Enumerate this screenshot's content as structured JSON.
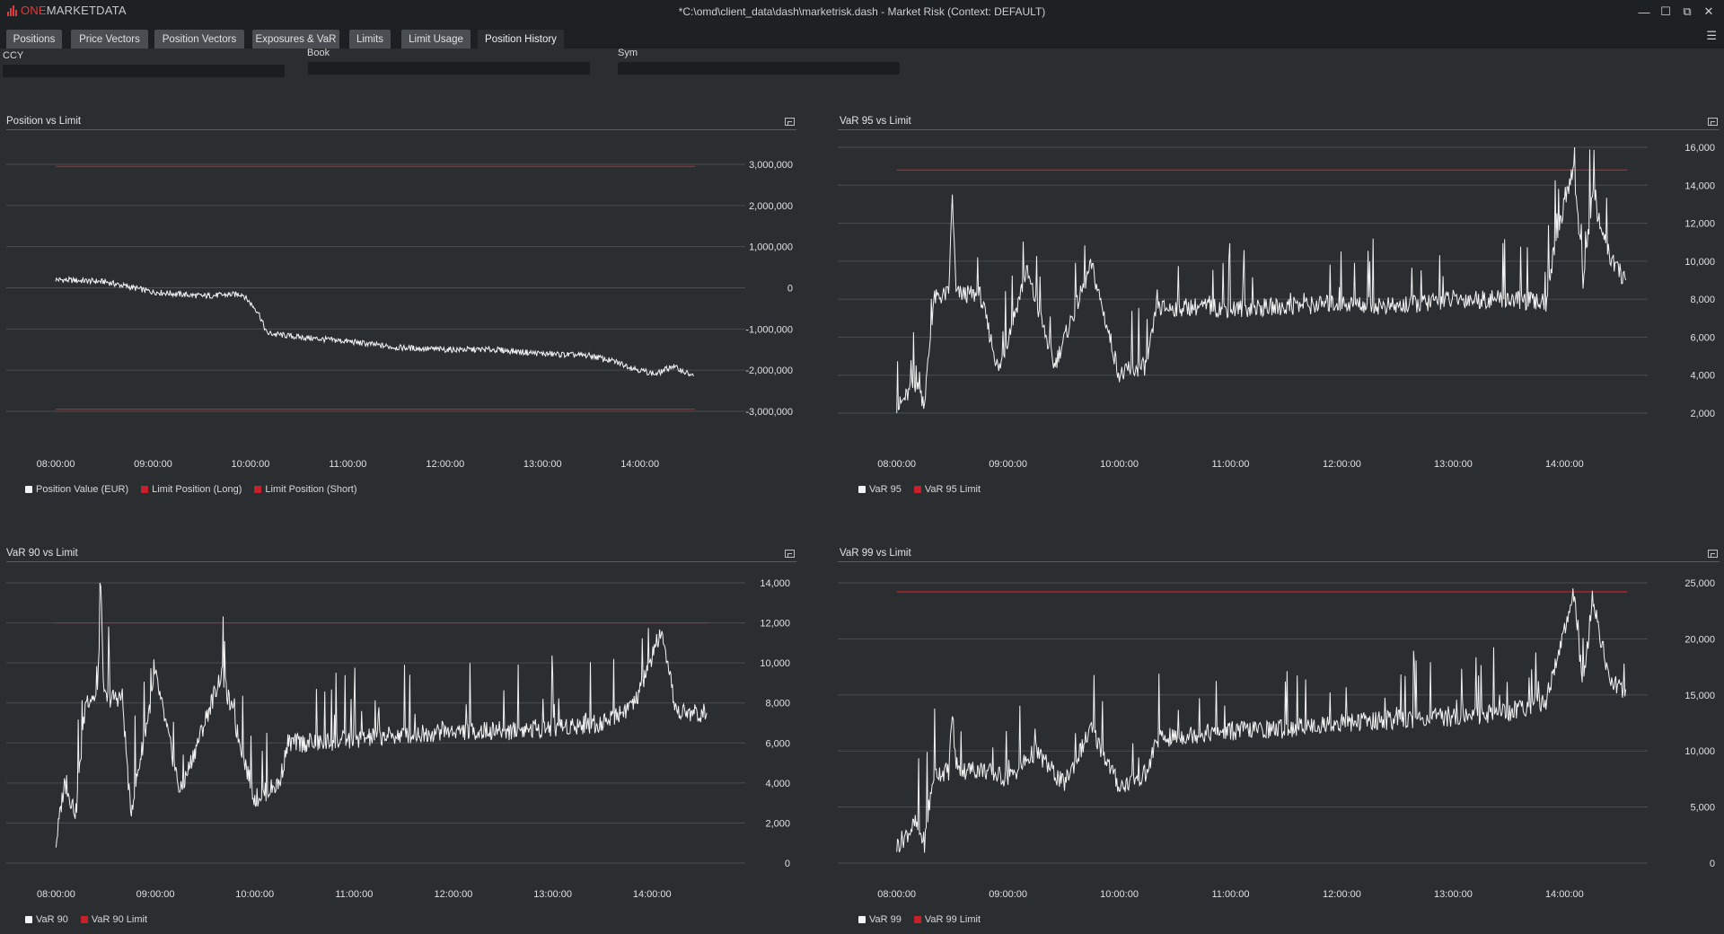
{
  "app": {
    "logo_one": "ONE",
    "logo_rest": "MARKETDATA",
    "window_title": "*C:\\omd\\client_data\\dash\\marketrisk.dash - Market Risk (Context: DEFAULT)",
    "controls": {
      "minimize": "—",
      "maximize": "☐",
      "restore": "⧉",
      "close": "✕"
    },
    "menu_icon": "☰"
  },
  "tabs": [
    {
      "label": "Positions",
      "active": false
    },
    {
      "label": "Price Vectors",
      "active": false
    },
    {
      "label": "Position Vectors",
      "active": false
    },
    {
      "label": "Exposures & VaR",
      "active": false
    },
    {
      "label": "Limits",
      "active": false
    },
    {
      "label": "Limit Usage",
      "active": false
    },
    {
      "label": "Position History",
      "active": true
    }
  ],
  "filters": {
    "ccy": {
      "label": "CCY",
      "value": "",
      "placeholder": ""
    },
    "book": {
      "label": "Book",
      "value": "",
      "placeholder": ""
    },
    "sym": {
      "label": "Sym",
      "value": "",
      "placeholder": ""
    }
  },
  "colors": {
    "background": "#2b2e31",
    "series_line": "#f2f2f2",
    "limit_line": "#c7202a",
    "grid": "#4a4d51",
    "tab": "#4a4d51"
  },
  "icons": {
    "panel_maximize": "panel-maximize-icon"
  },
  "chart_data": [
    {
      "id": "position",
      "type": "line",
      "title": "Position vs Limit",
      "x_ticks": [
        "08:00:00",
        "09:00:00",
        "10:00:00",
        "11:00:00",
        "12:00:00",
        "13:00:00",
        "14:00:00"
      ],
      "x_range": [
        "07:50",
        "14:40"
      ],
      "ylim": [
        -3000000,
        3000000
      ],
      "y_ticks": [
        -3000000,
        -2000000,
        -1000000,
        0,
        1000000,
        2000000,
        3000000
      ],
      "y_tick_labels": [
        "-3,000,000",
        "-2,000,000",
        "-1,000,000",
        "0",
        "1,000,000",
        "2,000,000",
        "3,000,000"
      ],
      "grid": true,
      "legend_position": "bottom-left",
      "series": [
        {
          "name": "Position Value (EUR)",
          "color": "#f2f2f2",
          "kind": "line",
          "points": [
            [
              "08:00",
              200000
            ],
            [
              "08:30",
              150000
            ],
            [
              "09:00",
              -100000
            ],
            [
              "09:30",
              -200000
            ],
            [
              "09:55",
              -150000
            ],
            [
              "10:05",
              -600000
            ],
            [
              "10:10",
              -1100000
            ],
            [
              "10:30",
              -1200000
            ],
            [
              "11:00",
              -1300000
            ],
            [
              "11:30",
              -1450000
            ],
            [
              "12:00",
              -1500000
            ],
            [
              "12:30",
              -1500000
            ],
            [
              "13:00",
              -1600000
            ],
            [
              "13:30",
              -1650000
            ],
            [
              "13:45",
              -1800000
            ],
            [
              "14:00",
              -2000000
            ],
            [
              "14:10",
              -2100000
            ],
            [
              "14:20",
              -1900000
            ],
            [
              "14:33",
              -2150000
            ]
          ]
        },
        {
          "name": "Limit Position (Long)",
          "color": "#c7202a",
          "kind": "limit",
          "value": 2950000
        },
        {
          "name": "Limit Position (Short)",
          "color": "#c7202a",
          "kind": "limit",
          "value": -2950000
        }
      ]
    },
    {
      "id": "var95",
      "type": "line",
      "title": "VaR 95 vs Limit",
      "x_ticks": [
        "08:00:00",
        "09:00:00",
        "10:00:00",
        "11:00:00",
        "12:00:00",
        "13:00:00",
        "14:00:00"
      ],
      "x_range": [
        "07:50",
        "14:40"
      ],
      "ylim": [
        2000,
        16000
      ],
      "y_ticks": [
        2000,
        4000,
        6000,
        8000,
        10000,
        12000,
        14000,
        16000
      ],
      "y_tick_labels": [
        "2,000",
        "4,000",
        "6,000",
        "8,000",
        "10,000",
        "12,000",
        "14,000",
        "16,000"
      ],
      "grid": true,
      "legend_position": "bottom-left",
      "series": [
        {
          "name": "VaR 95",
          "color": "#f2f2f2",
          "kind": "line",
          "points": [
            [
              "08:00",
              2200
            ],
            [
              "08:10",
              3500
            ],
            [
              "08:15",
              2600
            ],
            [
              "08:20",
              8000
            ],
            [
              "08:28",
              8300
            ],
            [
              "08:30",
              13500
            ],
            [
              "08:32",
              8300
            ],
            [
              "08:45",
              8200
            ],
            [
              "08:55",
              4200
            ],
            [
              "09:10",
              9500
            ],
            [
              "09:25",
              4500
            ],
            [
              "09:45",
              9800
            ],
            [
              "10:00",
              4000
            ],
            [
              "10:15",
              4500
            ],
            [
              "10:20",
              7500
            ],
            [
              "10:40",
              7600
            ],
            [
              "11:00",
              7500
            ],
            [
              "11:30",
              7600
            ],
            [
              "12:00",
              7800
            ],
            [
              "12:30",
              7600
            ],
            [
              "13:00",
              8000
            ],
            [
              "13:30",
              8000
            ],
            [
              "13:50",
              7800
            ],
            [
              "13:55",
              11000
            ],
            [
              "14:05",
              15000
            ],
            [
              "14:10",
              9000
            ],
            [
              "14:15",
              13500
            ],
            [
              "14:25",
              10000
            ],
            [
              "14:33",
              9000
            ]
          ]
        },
        {
          "name": "VaR 95 Limit",
          "color": "#c7202a",
          "kind": "limit",
          "value": 14800
        }
      ]
    },
    {
      "id": "var90",
      "type": "line",
      "title": "VaR 90 vs Limit",
      "x_ticks": [
        "08:00:00",
        "09:00:00",
        "10:00:00",
        "11:00:00",
        "12:00:00",
        "13:00:00",
        "14:00:00"
      ],
      "x_range": [
        "07:50",
        "14:40"
      ],
      "ylim": [
        0,
        14000
      ],
      "y_ticks": [
        0,
        2000,
        4000,
        6000,
        8000,
        10000,
        12000,
        14000
      ],
      "y_tick_labels": [
        "0",
        "2,000",
        "4,000",
        "6,000",
        "8,000",
        "10,000",
        "12,000",
        "14,000"
      ],
      "grid": true,
      "legend_position": "bottom-left",
      "series": [
        {
          "name": "VaR 90",
          "color": "#f2f2f2",
          "kind": "line",
          "points": [
            [
              "08:00",
              1000
            ],
            [
              "08:05",
              4000
            ],
            [
              "08:12",
              2500
            ],
            [
              "08:18",
              8200
            ],
            [
              "08:25",
              8300
            ],
            [
              "08:27",
              13800
            ],
            [
              "08:29",
              8200
            ],
            [
              "08:40",
              8300
            ],
            [
              "08:45",
              2500
            ],
            [
              "09:00",
              9400
            ],
            [
              "09:15",
              3500
            ],
            [
              "09:40",
              9500
            ],
            [
              "10:00",
              3200
            ],
            [
              "10:15",
              4000
            ],
            [
              "10:20",
              6000
            ],
            [
              "10:40",
              6000
            ],
            [
              "11:00",
              6200
            ],
            [
              "11:30",
              6400
            ],
            [
              "12:00",
              6600
            ],
            [
              "12:30",
              6600
            ],
            [
              "13:00",
              6800
            ],
            [
              "13:30",
              7000
            ],
            [
              "13:50",
              8000
            ],
            [
              "14:05",
              11500
            ],
            [
              "14:15",
              7500
            ],
            [
              "14:33",
              7500
            ]
          ]
        },
        {
          "name": "VaR 90 Limit",
          "color": "#c7202a",
          "kind": "limit",
          "value": 12000
        }
      ]
    },
    {
      "id": "var99",
      "type": "line",
      "title": "VaR 99 vs Limit",
      "x_ticks": [
        "08:00:00",
        "09:00:00",
        "10:00:00",
        "11:00:00",
        "12:00:00",
        "13:00:00",
        "14:00:00"
      ],
      "x_range": [
        "07:50",
        "14:40"
      ],
      "ylim": [
        0,
        25000
      ],
      "y_ticks": [
        0,
        5000,
        10000,
        15000,
        20000,
        25000
      ],
      "y_tick_labels": [
        "0",
        "5,000",
        "10,000",
        "15,000",
        "20,000",
        "25,000"
      ],
      "grid": true,
      "legend_position": "bottom-left",
      "series": [
        {
          "name": "VaR 99",
          "color": "#f2f2f2",
          "kind": "line",
          "points": [
            [
              "08:00",
              1500
            ],
            [
              "08:10",
              3500
            ],
            [
              "08:15",
              1800
            ],
            [
              "08:20",
              8000
            ],
            [
              "08:28",
              8200
            ],
            [
              "08:30",
              13500
            ],
            [
              "08:32",
              8200
            ],
            [
              "08:45",
              8400
            ],
            [
              "09:00",
              7500
            ],
            [
              "09:15",
              10000
            ],
            [
              "09:30",
              7000
            ],
            [
              "09:45",
              12000
            ],
            [
              "10:00",
              6800
            ],
            [
              "10:15",
              8000
            ],
            [
              "10:20",
              11000
            ],
            [
              "10:40",
              11500
            ],
            [
              "11:00",
              11800
            ],
            [
              "11:30",
              12000
            ],
            [
              "12:00",
              12500
            ],
            [
              "12:30",
              12800
            ],
            [
              "13:00",
              13000
            ],
            [
              "13:30",
              13500
            ],
            [
              "13:50",
              14500
            ],
            [
              "14:05",
              24000
            ],
            [
              "14:10",
              15500
            ],
            [
              "14:15",
              23500
            ],
            [
              "14:25",
              16000
            ],
            [
              "14:33",
              15500
            ]
          ]
        },
        {
          "name": "VaR 99 Limit",
          "color": "#c7202a",
          "kind": "limit",
          "value": 24200
        }
      ]
    }
  ]
}
